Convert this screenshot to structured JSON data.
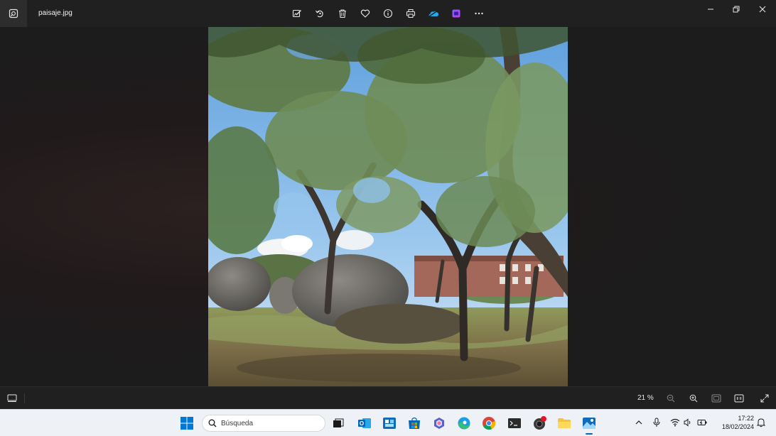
{
  "titlebar": {
    "filename": "paisaje.jpg",
    "app_icon": "photos-app-icon",
    "toolbar": [
      {
        "name": "edit-image",
        "icon": "edit-image-icon"
      },
      {
        "name": "rotate",
        "icon": "rotate-icon"
      },
      {
        "name": "delete",
        "icon": "trash-icon"
      },
      {
        "name": "favorite",
        "icon": "heart-icon"
      },
      {
        "name": "file-info",
        "icon": "info-icon"
      },
      {
        "name": "print",
        "icon": "printer-icon"
      },
      {
        "name": "onedrive",
        "icon": "onedrive-icon"
      },
      {
        "name": "clipchamp",
        "icon": "clipchamp-icon"
      },
      {
        "name": "more-options",
        "icon": "ellipsis-icon"
      }
    ],
    "window_controls": [
      "minimize",
      "restore",
      "close"
    ]
  },
  "viewer": {
    "image": "landscape photo: oak trees, large granite boulders, blue sky with clouds, brick building in background"
  },
  "bottombar": {
    "zoom_level": "21 %",
    "buttons": [
      "filmstrip",
      "zoom-out",
      "zoom-in",
      "fit-to-window",
      "actual-size",
      "full-screen"
    ]
  },
  "taskbar": {
    "search_placeholder": "Búsqueda",
    "apps": [
      "start",
      "task-view",
      "outlook",
      "microsoft-store-preview",
      "microsoft-store",
      "copilot",
      "edge",
      "chrome",
      "terminal",
      "camera",
      "file-explorer",
      "photos"
    ],
    "active_app": "photos",
    "clock": {
      "time": "17:22",
      "date": "18/02/2024"
    }
  },
  "colors": {
    "titlebar_bg": "#202020",
    "viewer_bg": "#1c1c1c",
    "taskbar_bg": "#eef1f6",
    "accent": "#0067c0",
    "sky": "#7fb6e8",
    "foliage": "#5f7d4a",
    "boulder": "#7a7570",
    "ground": "#8a7b52"
  }
}
